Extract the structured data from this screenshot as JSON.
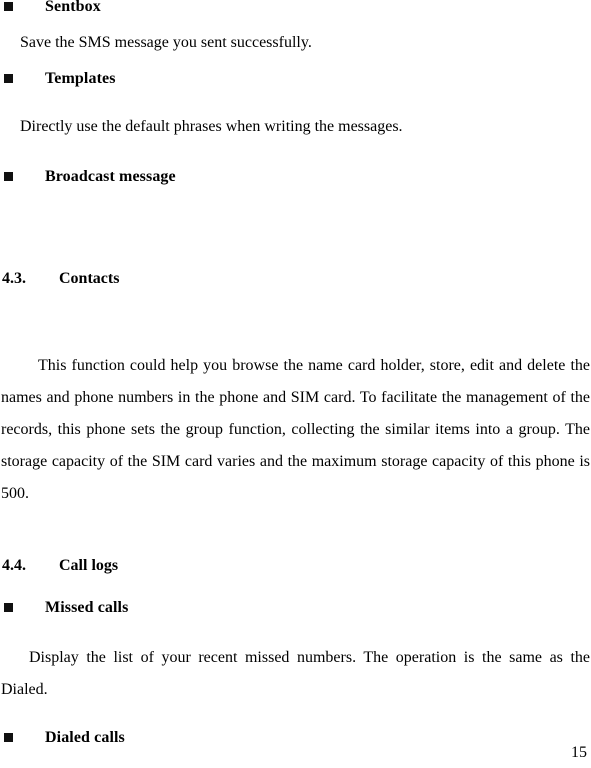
{
  "document": {
    "page_number": "15",
    "bullet_glyph": "filled-square"
  },
  "blocks": {
    "sentbox_heading": "Sentbox",
    "sentbox_body": "Save the SMS message you sent successfully.",
    "templates_heading": "Templates",
    "templates_body": "Directly use the default phrases when writing the messages.",
    "broadcast_heading": "Broadcast message",
    "contacts_section_number": "4.3.",
    "contacts_section_title": "Contacts",
    "contacts_body": "This function could help you browse the name card holder, store, edit and delete the names and phone numbers in the phone and SIM card. To facilitate the management of the records, this phone sets the group function, collecting the similar items into a group. The storage capacity of the SIM card varies and the maximum storage capacity of this phone is 500.",
    "calllogs_section_number": "4.4.",
    "calllogs_section_title": "Call logs",
    "missed_heading": "Missed calls",
    "missed_body": "Display the list of your recent missed numbers. The operation is the same as the Dialed.",
    "dialed_heading": "Dialed calls"
  }
}
